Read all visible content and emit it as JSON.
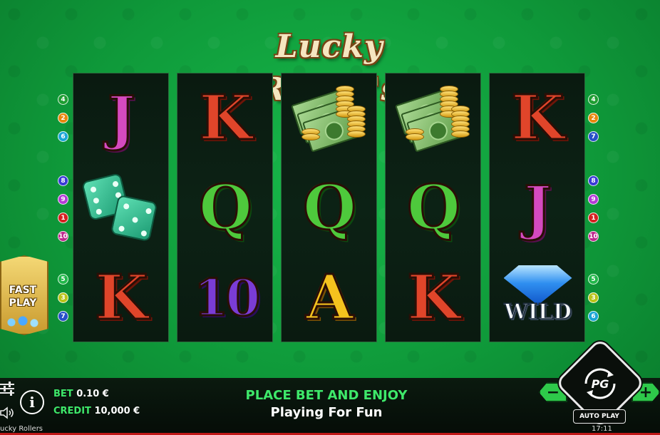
{
  "game": {
    "logo_text": "Lucky Roller's",
    "name_footer": "ucky Rollers"
  },
  "reels": [
    [
      "J",
      "dice",
      "K"
    ],
    [
      "K",
      "Q",
      "10"
    ],
    [
      "money",
      "Q",
      "A"
    ],
    [
      "money",
      "Q",
      "K"
    ],
    [
      "K",
      "J",
      "wild"
    ]
  ],
  "symbols": {
    "wild_label": "WILD"
  },
  "paylines": {
    "left": [
      {
        "n": "4",
        "color": "#1f9e32"
      },
      {
        "n": "2",
        "color": "#e8870c"
      },
      {
        "n": "6",
        "color": "#1aa6d6"
      },
      {
        "n": "8",
        "color": "#3a3ad6"
      },
      {
        "n": "9",
        "color": "#b43ad6"
      },
      {
        "n": "1",
        "color": "#d62020"
      },
      {
        "n": "10",
        "color": "#c0288e"
      },
      {
        "n": "5",
        "color": "#22b84a"
      },
      {
        "n": "3",
        "color": "#b8c418"
      },
      {
        "n": "7",
        "color": "#2850c8"
      }
    ],
    "right": [
      {
        "n": "4",
        "color": "#1f9e32"
      },
      {
        "n": "2",
        "color": "#e8870c"
      },
      {
        "n": "7",
        "color": "#2850c8"
      },
      {
        "n": "8",
        "color": "#3a3ad6"
      },
      {
        "n": "9",
        "color": "#b43ad6"
      },
      {
        "n": "1",
        "color": "#d62020"
      },
      {
        "n": "10",
        "color": "#c0288e"
      },
      {
        "n": "5",
        "color": "#22b84a"
      },
      {
        "n": "3",
        "color": "#b8c418"
      },
      {
        "n": "6",
        "color": "#1aa6d6"
      }
    ]
  },
  "fast_play": {
    "label_line1": "FAST",
    "label_line2": "PLAY"
  },
  "footer": {
    "bet_label": "BET",
    "bet_value": "0.10 €",
    "credit_label": "CREDIT",
    "credit_value": "10,000 €",
    "message_top": "PLACE BET AND ENJOY",
    "message_bottom": "Playing For Fun",
    "clock": "17:11",
    "info_glyph": "i"
  },
  "controls": {
    "minus_label": "−",
    "plus_label": "+",
    "spin_logo": "PG",
    "auto_play_label": "AUTO PLAY"
  },
  "colors": {
    "felt": "#14a843",
    "accent_green": "#3ee86a",
    "reel_bg": "#0b1d12"
  }
}
